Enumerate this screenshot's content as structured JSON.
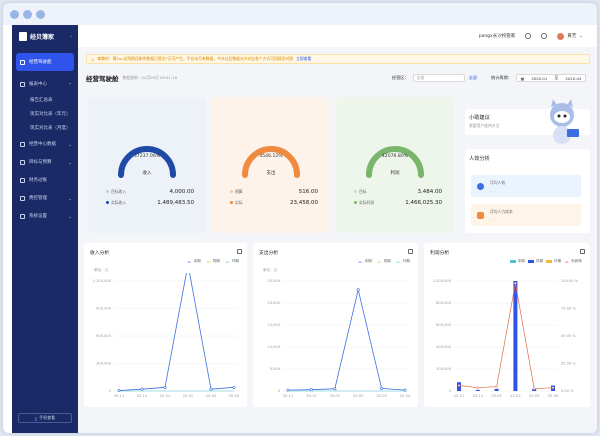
{
  "app": {
    "title": "经贝簿家"
  },
  "sidebar": {
    "items": [
      {
        "label": "经营驾驶舱",
        "active": true
      },
      {
        "label": "报表中心",
        "expanded": true
      },
      {
        "label": "报告汇总表"
      },
      {
        "label": "现实对比表（年元）"
      },
      {
        "label": "现实对比表（月度）"
      },
      {
        "label": "经营中心数据"
      },
      {
        "label": "目标与预算"
      },
      {
        "label": "财务过账"
      },
      {
        "label": "费控管理"
      },
      {
        "label": "系统设置"
      }
    ],
    "mobile_btn": "手机查看"
  },
  "topbar": {
    "company": "pangx长沙校管家",
    "user": "黄芳"
  },
  "notice": {
    "text": "尊敬的：黄Sun试用期还剩余数据已提交7天可产生，平台本月有数据，今年过后数据允许对比各个方式可回顾及对照",
    "link": "立即查看"
  },
  "page": {
    "title": "经营驾驶舱",
    "updated": "数据更新：04月09日 09:51:18",
    "filter_label": "经营区：",
    "filter_placeholder": "全部",
    "filter_all": "全部",
    "period_label": "统计周期：",
    "date_from": "2020-01",
    "date_to": "2020-04",
    "date_sep": "至"
  },
  "gauges": [
    {
      "name": "收入",
      "pct": "37237.06%",
      "color": "#1f4aa8",
      "bg": "#edf1f8",
      "rows": [
        {
          "label": "目标收入",
          "value": "4,000.00"
        },
        {
          "label": "实际收入",
          "value": "1,489,483.50"
        }
      ]
    },
    {
      "name": "支出",
      "pct": "4546.12%",
      "color": "#ef8a3e",
      "bg": "#fdf3ea",
      "rows": [
        {
          "label": "预算",
          "value": "516.00"
        },
        {
          "label": "实际",
          "value": "23,458.00"
        }
      ]
    },
    {
      "name": "利润",
      "pct": "42076.80%",
      "color": "#79b56a",
      "bg": "#eef6ec",
      "rows": [
        {
          "label": "目标",
          "value": "3,484.00"
        },
        {
          "label": "实际利润",
          "value": "1,466,025.30"
        }
      ]
    }
  ],
  "tips": {
    "title": "小助建议",
    "sub": "需要用户维持关注"
  },
  "hr": {
    "title": "人效分析",
    "items": [
      {
        "label": "月均人效",
        "value": "-"
      },
      {
        "label": "月均人力成本",
        "value": "-"
      }
    ]
  },
  "charts": {
    "income": {
      "title": "收入分析",
      "unit": "单位：元",
      "legend": [
        "本期",
        "同期",
        "环期"
      ]
    },
    "expense": {
      "title": "支出分析",
      "unit": "单位：元",
      "legend": [
        "本期",
        "同期",
        "环期"
      ]
    },
    "profit": {
      "title": "利润分析",
      "legend": [
        "本期",
        "同期",
        "环期",
        "利润率"
      ]
    }
  },
  "chart_data": [
    {
      "type": "line",
      "title": "收入分析",
      "x": [
        "20-11",
        "20-12",
        "20-01",
        "20-02",
        "20-03",
        "20-04"
      ],
      "ylim": [
        0,
        1200000
      ],
      "yticks": [
        "0",
        "300,000",
        "600,000",
        "900,000",
        "1,200,000"
      ],
      "series": [
        {
          "name": "本期",
          "values": [
            5000,
            20000,
            40000,
            1380000,
            20000,
            40000
          ]
        }
      ]
    },
    {
      "type": "line",
      "title": "支出分析",
      "x": [
        "20-11",
        "20-12",
        "20-01",
        "20-02",
        "20-03",
        "20-04"
      ],
      "ylim": [
        0,
        20000
      ],
      "yticks": [
        "0",
        "5,000",
        "10,000",
        "15,000",
        "20,000",
        "25,000"
      ],
      "series": [
        {
          "name": "本期",
          "values": [
            200,
            300,
            500,
            23000,
            600,
            200
          ]
        }
      ]
    },
    {
      "type": "bar",
      "title": "利润分析",
      "x": [
        "20-11",
        "20-12",
        "20-01",
        "20-02",
        "20-03",
        "20-04"
      ],
      "ylim": [
        0,
        1000000
      ],
      "yticks": [
        "0",
        "200,000",
        "400,000",
        "600,000",
        "800,000",
        "1,000,000"
      ],
      "y2ticks": [
        "0.00 %",
        "25.00 %",
        "50.00 %",
        "75.00 %",
        "100.00 %"
      ],
      "series": [
        {
          "name": "本期",
          "values": [
            80000,
            10000,
            20000,
            1000000,
            20000,
            50000
          ]
        },
        {
          "name": "利润率",
          "values": [
            5,
            3,
            4,
            98,
            2,
            3
          ]
        }
      ]
    }
  ],
  "colors": {
    "accent": "#2f54eb",
    "sidebar": "#1a2a66"
  }
}
